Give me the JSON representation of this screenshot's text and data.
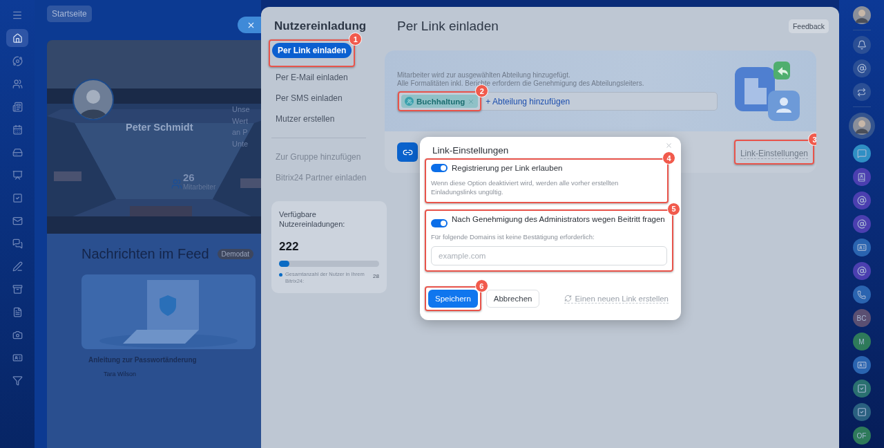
{
  "left_sidebar": {
    "items": [
      {
        "selected": false
      },
      {
        "selected": true
      },
      {
        "selected": false
      },
      {
        "selected": false
      },
      {
        "selected": false
      },
      {
        "selected": false
      },
      {
        "selected": false
      },
      {
        "selected": false
      },
      {
        "selected": false
      },
      {
        "selected": false
      },
      {
        "selected": false
      },
      {
        "selected": false
      },
      {
        "selected": false
      },
      {
        "selected": false
      },
      {
        "selected": false
      },
      {
        "selected": false
      },
      {
        "selected": false
      }
    ]
  },
  "background": {
    "breadcrumb": "Startseite",
    "profile": {
      "name": "Peter Schmidt",
      "about_lines": [
        "Unse",
        "Wert",
        "an P",
        "Unte"
      ],
      "count": "26",
      "count_label": "Mitarbeiter"
    },
    "feed": {
      "title": "Nachrichten im Feed",
      "badge": "Demodat",
      "post": {
        "title": "Anleitung zur Passwortänderung",
        "author": "Tara Wilson"
      }
    }
  },
  "panel": {
    "nav": {
      "title": "Nutzereinladung",
      "items": [
        {
          "label": "Per Link einladen",
          "selected": true,
          "disabled": false,
          "annotation": "1"
        },
        {
          "label": "Per E-Mail einladen",
          "selected": false,
          "disabled": false
        },
        {
          "label": "Per SMS einladen",
          "selected": false,
          "disabled": false
        },
        {
          "label": "Mutzer erstellen",
          "selected": false,
          "disabled": false
        },
        {
          "label": "Zur Gruppe hinzufügen",
          "selected": false,
          "disabled": true
        },
        {
          "label": "Bitrix24 Partner einladen",
          "selected": false,
          "disabled": true
        }
      ],
      "quota": {
        "title": "Verfügbare Nutzereinladungen:",
        "count": "222",
        "level": 0.1,
        "legend": "Gesamtanzahl der Nutzer in Ihrem Bitrix24:",
        "total": "28"
      }
    },
    "title": "Per Link einladen",
    "feedback": "Feedback",
    "card": {
      "description": [
        "Mitarbeiter wird zur ausgewählten Abteilung hinzugefügt.",
        "Alle Formalitäten inkl. Berichte erfordern die Genehmigung des Abteilungsleiters."
      ],
      "tag": {
        "label": "Buchhaltung",
        "annotation": "2"
      },
      "add_link": "+ Abteilung hinzufügen",
      "settings_link": {
        "label": "Link-Einstellungen",
        "annotation": "3"
      }
    }
  },
  "dialog": {
    "title": "Link-Einstellungen",
    "options": [
      {
        "label": "Registrierung per Link erlauben",
        "on": true,
        "hint": "Wenn diese Option deaktiviert wird, werden alle vorher erstellten Einladungslinks ungültig.",
        "annotation": "4"
      },
      {
        "label": "Nach Genehmigung des Administrators wegen Beitritt fragen",
        "on": true,
        "hint": "Für folgende Domains ist keine Bestätigung erforderlich:",
        "placeholder": "example.com",
        "annotation": "5"
      }
    ],
    "save": {
      "label": "Speichern",
      "annotation": "6"
    },
    "cancel": "Abbrechen",
    "regenerate": "Einen neuen Link erstellen"
  },
  "right_bar": {
    "items": [
      {
        "kind": "avatar",
        "selected": false
      },
      {
        "kind": "bell"
      },
      {
        "kind": "copilot"
      },
      {
        "kind": "swap"
      },
      {
        "kind": "avatar",
        "selected": true
      },
      {
        "kind": "chat",
        "color": "#2f8fc4"
      },
      {
        "kind": "book",
        "color": "#4b3fb0"
      },
      {
        "kind": "copilot",
        "color": "#4b3fb0"
      },
      {
        "kind": "copilot",
        "color": "#4b3fb0"
      },
      {
        "kind": "card",
        "color": "#2a64b0"
      },
      {
        "kind": "copilot",
        "color": "#4b3fb0"
      },
      {
        "kind": "phone",
        "color": "#2a64b0"
      },
      {
        "kind": "initials",
        "text": "BC",
        "color": "#5a4f72"
      },
      {
        "kind": "initials",
        "text": "M",
        "color": "#2e7a5a"
      },
      {
        "kind": "card",
        "color": "#2a64b0"
      },
      {
        "kind": "check",
        "color": "#2a7070"
      },
      {
        "kind": "check",
        "color": "#2a6080"
      },
      {
        "kind": "initials",
        "text": "OF",
        "color": "#2e7a5a"
      }
    ]
  }
}
